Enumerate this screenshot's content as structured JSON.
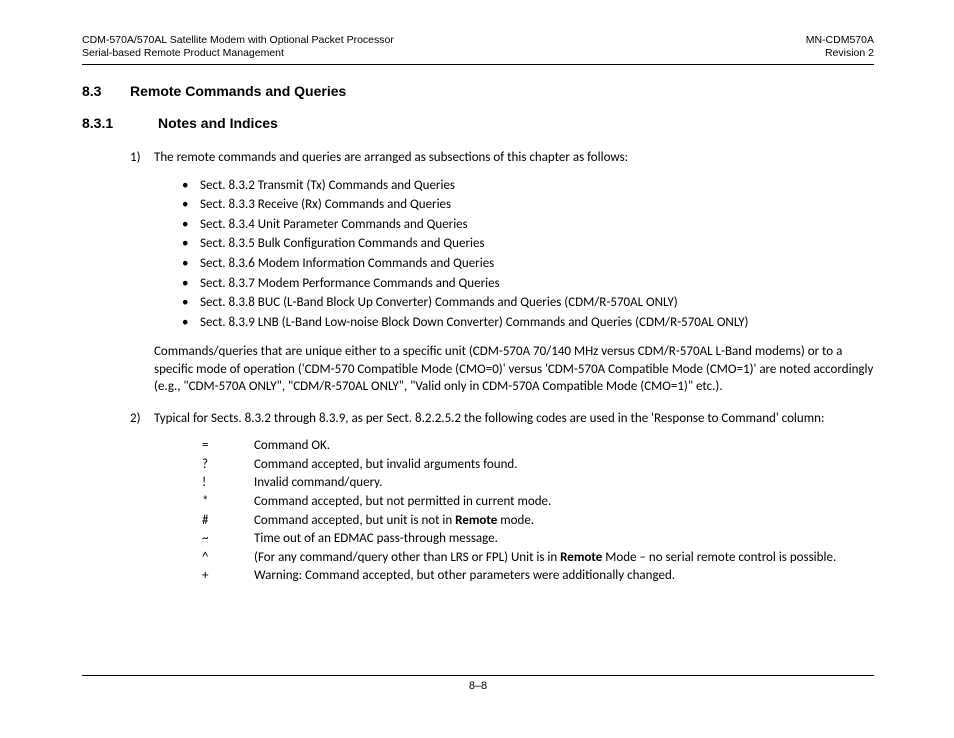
{
  "header": {
    "left_line1": "CDM-570A/570AL Satellite Modem with Optional Packet Processor",
    "left_line2": "Serial-based Remote Product Management",
    "right_line1": "MN-CDM570A",
    "right_line2": "Revision 2"
  },
  "section": {
    "num": "8.3",
    "title": "Remote Commands and Queries"
  },
  "subsection": {
    "num": "8.3.1",
    "title": "Notes and Indices"
  },
  "item1": {
    "label": "1)",
    "text": "The remote commands and queries are arranged as subsections of this chapter as follows:"
  },
  "bullets": [
    "Sect. 8.3.2 Transmit (Tx) Commands and Queries",
    "Sect. 8.3.3 Receive (Rx) Commands and Queries",
    "Sect. 8.3.4 Unit Parameter Commands and Queries",
    "Sect. 8.3.5 Bulk Configuration Commands and Queries",
    "Sect. 8.3.6 Modem Information Commands and Queries",
    "Sect. 8.3.7 Modem Performance Commands and Queries",
    "Sect. 8.3.8 BUC (L-Band Block Up Converter) Commands and Queries (CDM/R-570AL ONLY)",
    "Sect. 8.3.9 LNB (L-Band Low-noise Block Down Converter) Commands and Queries (CDM/R-570AL ONLY)"
  ],
  "para": "Commands/queries that are unique either to a specific unit (CDM-570A 70/140 MHz versus CDM/R-570AL L-Band modems) or to a specific mode of operation ('CDM-570 Compatible Mode (CMO=0)' versus 'CDM-570A Compatible Mode (CMO=1)' are noted accordingly (e.g.,  \"CDM-570A ONLY\", \"CDM/R-570AL ONLY\", \"Valid only in CDM-570A Compatible Mode (CMO=1)\" etc.).",
  "item2": {
    "label": "2)",
    "text": "Typical for Sects. 8.3.2 through 8.3.9, as per Sect. 8.2.2.5.2 the following codes are used in the 'Response to Command' column:"
  },
  "codes": [
    {
      "sym": "=",
      "desc": "Command OK."
    },
    {
      "sym": "?",
      "desc": "Command accepted, but invalid arguments found."
    },
    {
      "sym": "!",
      "desc": "Invalid command/query."
    },
    {
      "sym": "*",
      "desc": "Command accepted, but not permitted in current mode."
    },
    {
      "sym": "#",
      "desc_pre": "Command accepted, but unit is not in ",
      "bold": "Remote",
      "desc_post": " mode."
    },
    {
      "sym": "~",
      "desc": "Time out of an EDMAC pass-through message."
    },
    {
      "sym": "^",
      "desc_pre": "(For any command/query other than LRS or FPL) Unit is in ",
      "bold": "Remote",
      "desc_post": " Mode – no serial remote control is possible."
    },
    {
      "sym": "+",
      "desc": "Warning: Command accepted, but other parameters were additionally changed."
    }
  ],
  "footer": "8–8"
}
